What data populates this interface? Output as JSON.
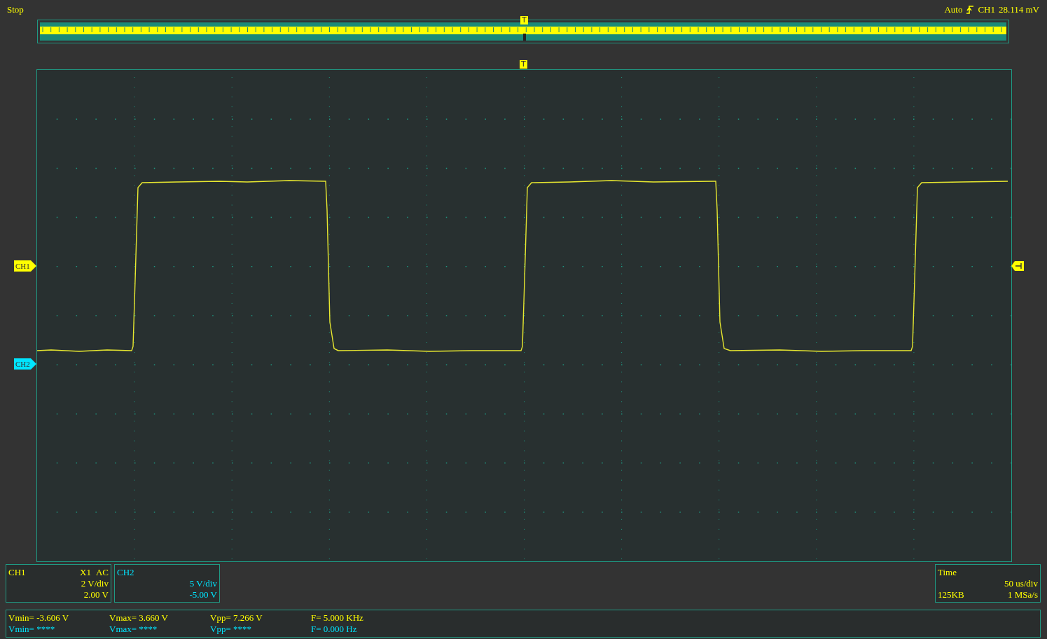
{
  "status": "Stop",
  "trigger": {
    "mode": "Auto",
    "source": "CH1",
    "level_reading": "28.114 mV"
  },
  "overview_marker": "T",
  "screen_marker": "T",
  "channel_markers": [
    {
      "label": "CH1",
      "color": "#ffff00"
    },
    {
      "label": "CH2",
      "color": "#00e5ff"
    }
  ],
  "channel_panels": [
    {
      "name": "CH1",
      "color": "#ffff00",
      "probe": "X1",
      "coupling": "AC",
      "scale": "2 V/div",
      "offset": "2.00 V"
    },
    {
      "name": "CH2",
      "color": "#00e5ff",
      "scale": "5 V/div",
      "offset": "-5.00 V"
    }
  ],
  "time_panel": {
    "title": "Time",
    "scale": "50 us/div",
    "memory": "125KB",
    "sample_rate": "1 MSa/s"
  },
  "measurements": [
    {
      "color": "#ffff00",
      "vmin": "Vmin= -3.606 V",
      "vmax": "Vmax= 3.660 V",
      "vpp": "Vpp= 7.266 V",
      "freq": "F= 5.000 KHz"
    },
    {
      "color": "#00e5ff",
      "vmin": "Vmin= ****",
      "vmax": "Vmax= ****",
      "vpp": "Vpp= ****",
      "freq": "F= 0.000 Hz"
    }
  ]
}
